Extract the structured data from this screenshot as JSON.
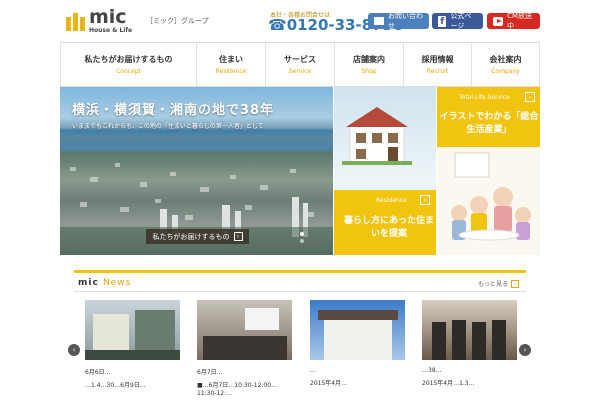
{
  "header": {
    "logo_word": "mic",
    "logo_sub": "House & Life",
    "group_label": "［ミック］グループ",
    "hq_label": "本社・各種お問合せは",
    "phone": "0120-33-8730",
    "buttons": {
      "contact": "お問い合わせ",
      "facebook": "公式ページ",
      "cm": "CM放送中"
    }
  },
  "nav": [
    {
      "jp": "私たちがお届けするもの",
      "en": "Concept"
    },
    {
      "jp": "住まい",
      "en": "Residence"
    },
    {
      "jp": "サービス",
      "en": "Service"
    },
    {
      "jp": "店舗案内",
      "en": "Shop"
    },
    {
      "jp": "採用情報",
      "en": "Recruit"
    },
    {
      "jp": "会社案内",
      "en": "Company"
    }
  ],
  "hero": {
    "title": "横浜・横須賀・湘南の地で38年",
    "subtitle": "いままでもこれからも、この地の「住まいと暮らしの第一人者」として",
    "button": "私たちがお届けするもの"
  },
  "residence": {
    "tag": "Residence",
    "text": "暮らし方にあった住まいを提案"
  },
  "life": {
    "tag": "Total Life Service",
    "text": "イラストでわかる「総合生活産業」"
  },
  "news": {
    "title_en": "News",
    "title_mic": "mic",
    "more": "もっと見る",
    "items": [
      {
        "head": "6月6日…",
        "body": "…1.4…30…6月9日…"
      },
      {
        "head": "6月7日…",
        "body": "■…6月7日…10:30-12:00…11:30-12:…"
      },
      {
        "head": "…",
        "body": "2015年4月…"
      },
      {
        "head": "…38…",
        "body": "2015年4月…1.3…"
      }
    ]
  },
  "colors": {
    "accent": "#f1c40f",
    "phone": "#3477b3",
    "contact_btn": "#4b80bd",
    "facebook_btn": "#3b5998",
    "cm_btn": "#d42a21"
  }
}
